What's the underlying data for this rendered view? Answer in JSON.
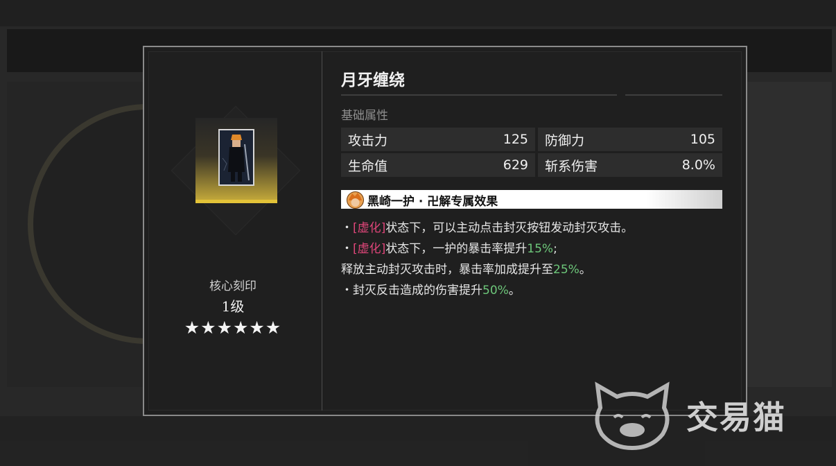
{
  "item": {
    "title": "月牙缠绕",
    "core_label": "核心刻印",
    "level": "1级",
    "stars": "★★★★★★",
    "star_count": 6
  },
  "base_stats": {
    "label": "基础属性",
    "items": [
      {
        "name": "攻击力",
        "value": "125"
      },
      {
        "name": "防御力",
        "value": "105"
      },
      {
        "name": "生命值",
        "value": "629"
      },
      {
        "name": "斩系伤害",
        "value": "8.0%"
      }
    ]
  },
  "exclusive": {
    "title": "黑崎一护 · 卍解专属效果",
    "lines": [
      {
        "prefix": "・",
        "keyword": "[虚化]",
        "text": "状态下，可以主动点击封灭按钮发动封灭攻击。",
        "num": "",
        "suffix": ""
      },
      {
        "prefix": "・",
        "keyword": "[虚化]",
        "text": "状态下，一护的暴击率提升",
        "num": "15%",
        "suffix": ";"
      },
      {
        "prefix": "",
        "keyword": "",
        "text": "释放主动封灭攻击时，暴击率加成提升至",
        "num": "25%",
        "suffix": "。"
      },
      {
        "prefix": "・",
        "keyword": "",
        "text": "封灭反击造成的伤害提升",
        "num": "50%",
        "suffix": "。"
      }
    ]
  },
  "watermark": {
    "text": "交易猫"
  },
  "colors": {
    "keyword": "#e0467a",
    "number": "#6dc77a",
    "rarity": "#e3c338"
  }
}
